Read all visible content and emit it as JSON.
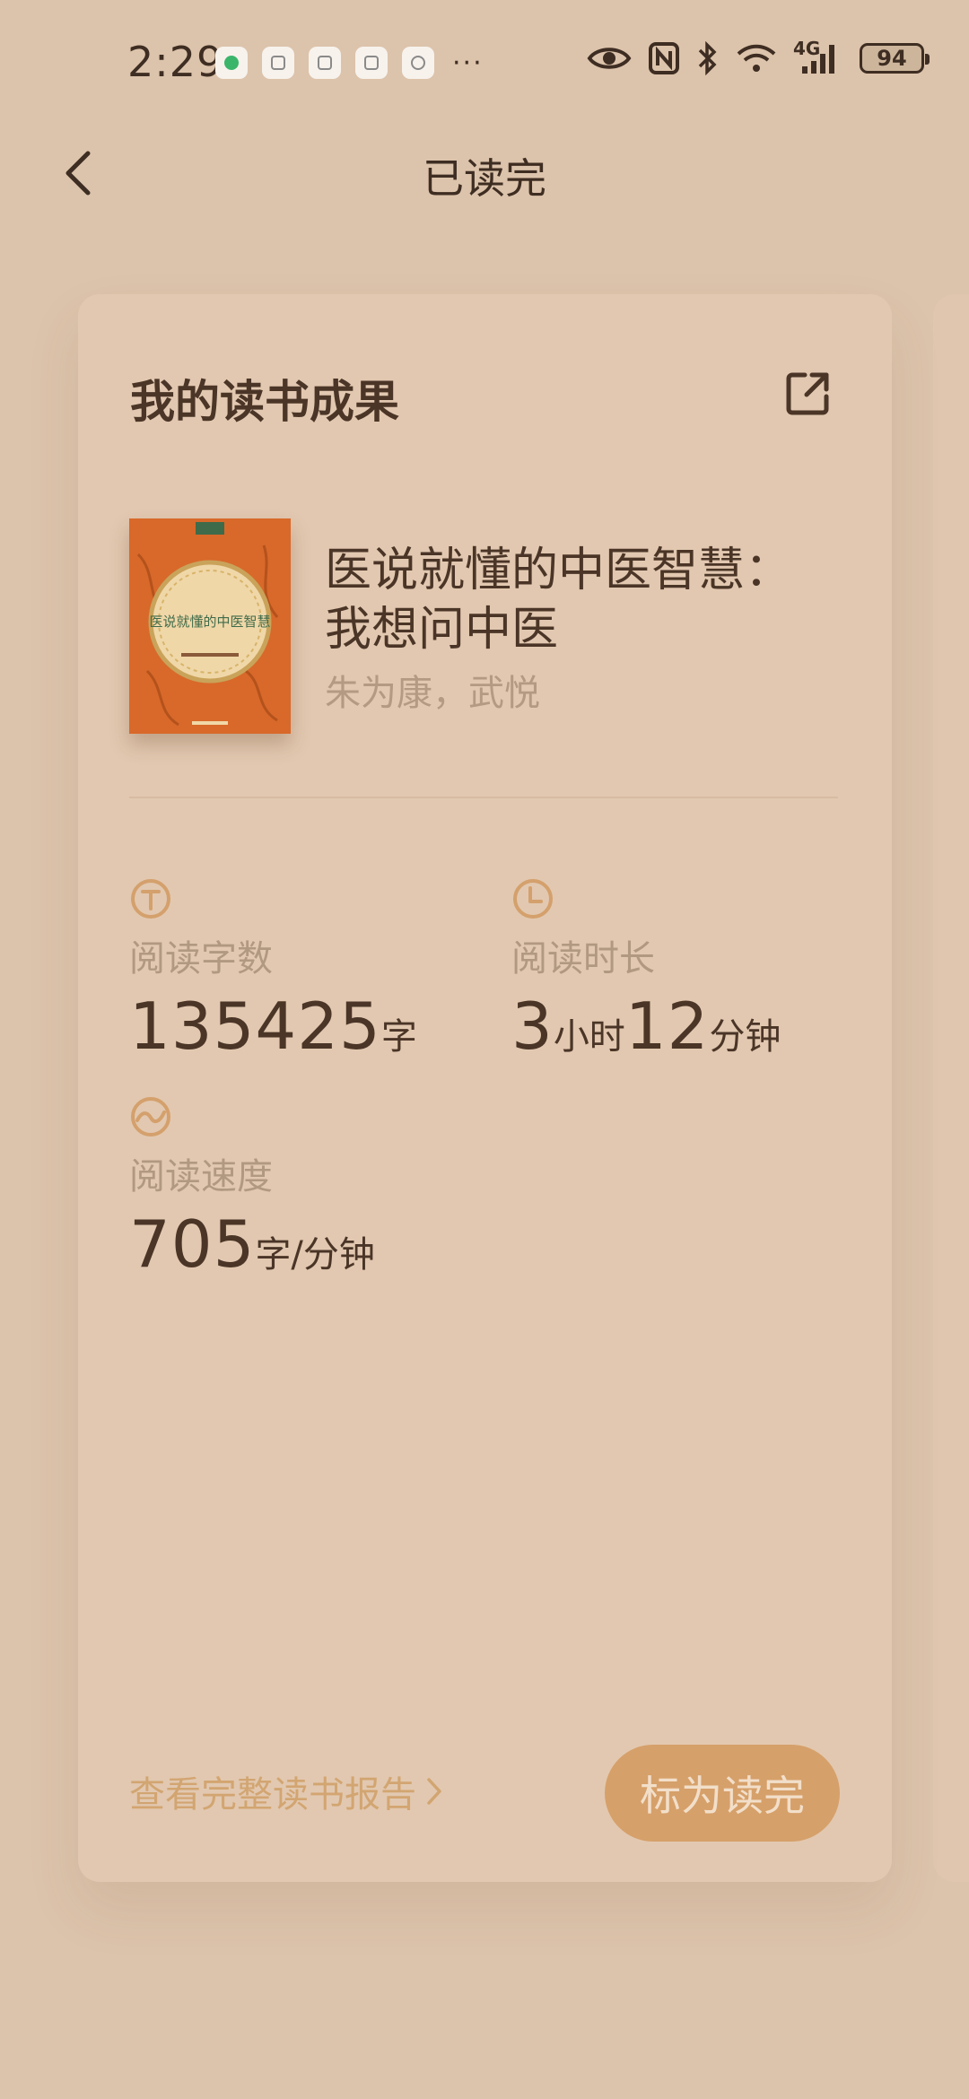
{
  "status_bar": {
    "time": "2:29",
    "more": "···",
    "network": "4G",
    "battery": "94",
    "notification_icons": [
      "money-app-icon",
      "reader-app-icon",
      "train-app-icon",
      "calendar-app-icon",
      "circle-app-icon"
    ]
  },
  "header": {
    "title": "已读完"
  },
  "card": {
    "title": "我的读书成果",
    "book": {
      "title": "医说就懂的中医智慧：我想问中医",
      "author": "朱为康，武悦",
      "cover_text": "医说就懂的中医智慧",
      "cover_color": "#d8692a"
    },
    "stats": {
      "word_count": {
        "label": "阅读字数",
        "value": "135425",
        "unit": "字",
        "icon": "text-t-icon"
      },
      "duration": {
        "label": "阅读时长",
        "hours": "3",
        "hours_unit": "小时",
        "minutes": "12",
        "minutes_unit": "分钟",
        "icon": "clock-icon"
      },
      "speed": {
        "label": "阅读速度",
        "value": "705",
        "unit": "字/分钟",
        "icon": "trend-icon"
      }
    },
    "report_link": "查看完整读书报告",
    "mark_button": "标为读完"
  },
  "colors": {
    "background": "#dcc3ab",
    "card": "#e2c8b0",
    "accent": "#d6a06a",
    "text": "#4a3527",
    "muted": "#b19880"
  }
}
